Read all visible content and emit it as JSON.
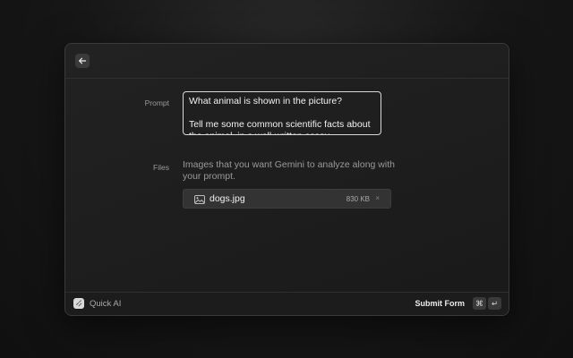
{
  "form": {
    "prompt_label": "Prompt",
    "prompt_value": "What animal is shown in the picture?\n\nTell me some common scientific facts about the animal, in a well-written essay.",
    "files_label": "Files",
    "files_description": "Images that you want Gemini to analyze along with your prompt.",
    "files": [
      {
        "name": "dogs.jpg",
        "size": "830 KB",
        "remove": "×"
      }
    ]
  },
  "footer": {
    "app_name": "Quick AI",
    "submit_label": "Submit Form",
    "shortcut_cmd": "⌘",
    "shortcut_enter": "↵"
  },
  "icons": {
    "back": "arrow-left-icon",
    "file": "image-file-icon",
    "app": "quick-ai-icon"
  }
}
